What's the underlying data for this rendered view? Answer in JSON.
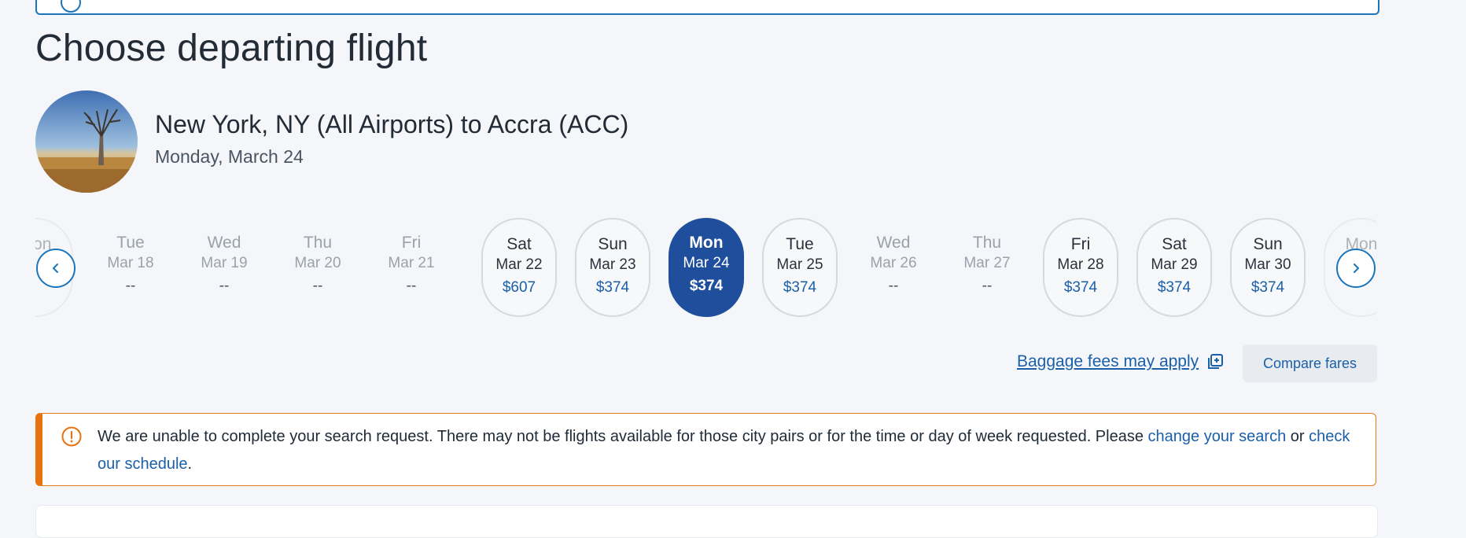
{
  "page": {
    "title": "Choose departing flight"
  },
  "route": {
    "title": "New York, NY (All Airports) to Accra (ACC)",
    "date": "Monday, March 24"
  },
  "dates": [
    {
      "dow": "Mon",
      "md": "",
      "price": "",
      "state": "edge"
    },
    {
      "dow": "Tue",
      "md": "Mar 18",
      "price": "--",
      "state": "muted"
    },
    {
      "dow": "Wed",
      "md": "Mar 19",
      "price": "--",
      "state": "muted"
    },
    {
      "dow": "Thu",
      "md": "Mar 20",
      "price": "--",
      "state": "muted"
    },
    {
      "dow": "Fri",
      "md": "Mar 21",
      "price": "--",
      "state": "muted"
    },
    {
      "dow": "Sat",
      "md": "Mar 22",
      "price": "$607",
      "state": "bordered"
    },
    {
      "dow": "Sun",
      "md": "Mar 23",
      "price": "$374",
      "state": "bordered"
    },
    {
      "dow": "Mon",
      "md": "Mar 24",
      "price": "$374",
      "state": "selected"
    },
    {
      "dow": "Tue",
      "md": "Mar 25",
      "price": "$374",
      "state": "bordered"
    },
    {
      "dow": "Wed",
      "md": "Mar 26",
      "price": "--",
      "state": "muted"
    },
    {
      "dow": "Thu",
      "md": "Mar 27",
      "price": "--",
      "state": "muted"
    },
    {
      "dow": "Fri",
      "md": "Mar 28",
      "price": "$374",
      "state": "bordered"
    },
    {
      "dow": "Sat",
      "md": "Mar 29",
      "price": "$374",
      "state": "bordered"
    },
    {
      "dow": "Sun",
      "md": "Mar 30",
      "price": "$374",
      "state": "bordered"
    },
    {
      "dow": "Mon",
      "md": "",
      "price": "",
      "state": "edge"
    }
  ],
  "actions": {
    "baggage_label": "Baggage fees may apply",
    "compare_label": "Compare fares"
  },
  "alert": {
    "text_before": "We are unable to complete your search request. There may not be flights available for those city pairs or for the time or day of week requested. Please ",
    "link1": "change your search",
    "middle": " or ",
    "link2": "check our schedule",
    "end": "."
  },
  "colors": {
    "accent": "#1b75bb",
    "selected": "#1f4f9c",
    "warning": "#e8720c"
  }
}
